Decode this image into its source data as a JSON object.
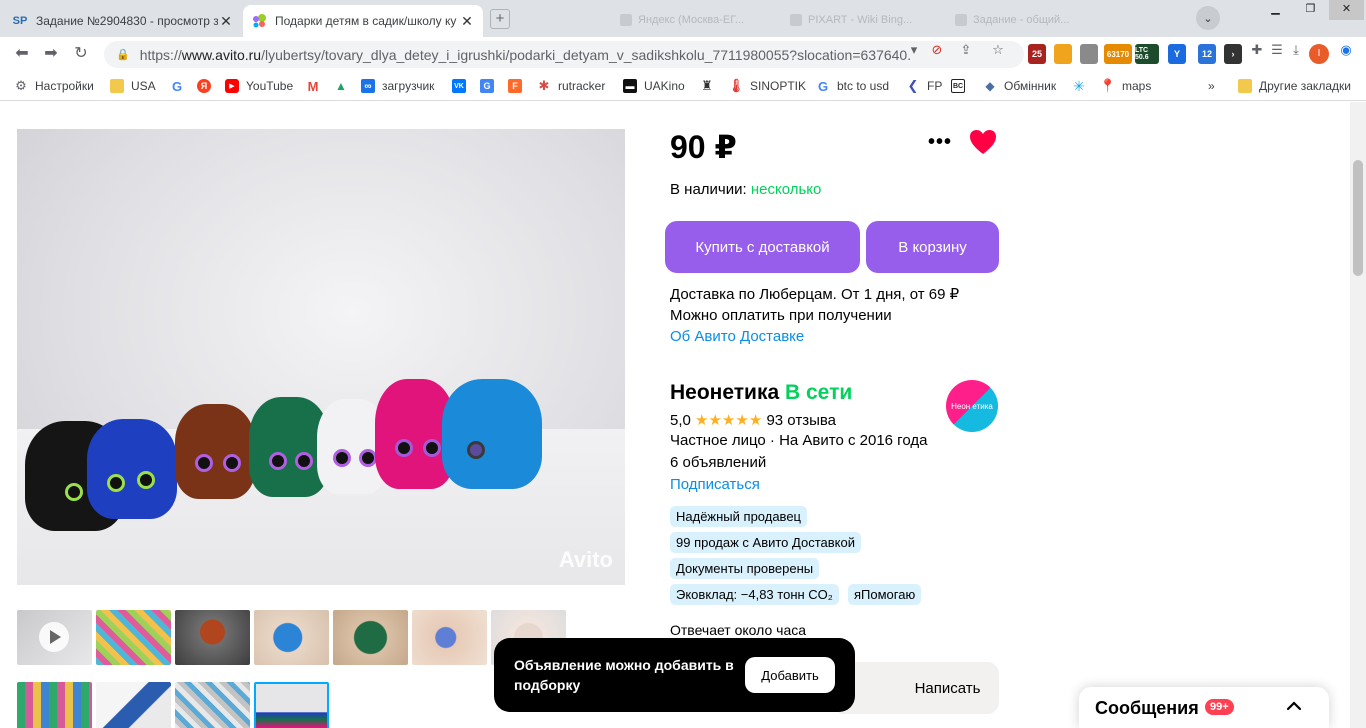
{
  "browser": {
    "tabs": [
      {
        "title": "Задание №2904830 - просмотр з",
        "favicon": "SP",
        "active": false
      },
      {
        "title": "Подарки детям в садик/школу ку",
        "favicon": "avito-logo",
        "active": true
      }
    ],
    "ghost_tabs": [
      "Яндекс (Москва-ЕГ...",
      "PIXART - Wiki Bing...",
      "Задание - общий..."
    ],
    "address": {
      "prefix": "https://",
      "host": "www.avito.ru",
      "path": "/lyubertsy/tovary_dlya_detey_i_igrushki/podarki_detyam_v_sadikshkolu_7711980055?slocation=637640..."
    },
    "extensions": [
      {
        "label": "25",
        "color": "#a8231f"
      },
      {
        "label": "",
        "color": "#f0a31c"
      },
      {
        "label": "",
        "color": "#8a8a8a"
      },
      {
        "label": "63170",
        "color": "#e68a00"
      },
      {
        "label": "LTC 50.6",
        "color": "#1c4c2c"
      },
      {
        "label": "",
        "color": "#1a6ae0"
      },
      {
        "label": "12",
        "color": "#2a73d9"
      },
      {
        "label": "",
        "color": "#333333"
      }
    ],
    "profile_initial": "I",
    "bookmarks": [
      {
        "label": "Настройки",
        "icon": "gear-icon",
        "color": "#5f6368"
      },
      {
        "label": "USA",
        "icon": "folder-icon",
        "color": "#f2c94c"
      },
      {
        "label": "",
        "icon": "google-icon",
        "color": "#4285f4"
      },
      {
        "label": "",
        "icon": "yandex-icon",
        "color": "#fc3f1d"
      },
      {
        "label": "YouTube",
        "icon": "youtube-icon",
        "color": "#ff0000"
      },
      {
        "label": "",
        "icon": "gmail-icon",
        "color": "#ea4335"
      },
      {
        "label": "",
        "icon": "drive-icon",
        "color": "#1fa463"
      },
      {
        "label": "загрузчик",
        "icon": "infinity-icon",
        "color": "#1a73e8"
      },
      {
        "label": "",
        "icon": "vk-icon",
        "color": "#0077ff"
      },
      {
        "label": "",
        "icon": "translate-icon",
        "color": "#4285f4"
      },
      {
        "label": "",
        "icon": "f-icon",
        "color": "#ff6a2b"
      },
      {
        "label": "rutracker",
        "icon": "rutracker-icon",
        "color": "#d84a4a"
      },
      {
        "label": "UAKino",
        "icon": "uakino-icon",
        "color": "#111111"
      },
      {
        "label": "",
        "icon": "person-icon",
        "color": "#333333"
      },
      {
        "label": "SINOPTIK",
        "icon": "thermometer-icon",
        "color": "#e53935"
      },
      {
        "label": "btc to usd",
        "icon": "google-icon",
        "color": "#4285f4"
      },
      {
        "label": "FP",
        "icon": "fp-icon",
        "color": "#3f51b5"
      },
      {
        "label": "",
        "icon": "bc-icon",
        "color": "#222222"
      },
      {
        "label": "Обмінник",
        "icon": "exchange-icon",
        "color": "#4a6fa5"
      },
      {
        "label": "",
        "icon": "star-burst-icon",
        "color": "#1aa3e8"
      },
      {
        "label": "maps",
        "icon": "maps-icon",
        "color": "#34a853"
      }
    ],
    "bookmarks_overflow": "»",
    "other_bookmarks": "Другие закладки"
  },
  "listing": {
    "price": "90 ₽",
    "stock_label": "В наличии:",
    "stock_value": "несколько",
    "buy_button": "Купить с доставкой",
    "cart_button": "В корзину",
    "delivery_line": "Доставка по Люберцам. От 1 дня, от 69 ₽",
    "payment_line": "Можно оплатить при получении",
    "delivery_link": "Об Авито Доставке",
    "photo_watermark": "Avito"
  },
  "seller": {
    "name": "Неонетика",
    "status": "В сети",
    "rating": "5,0",
    "stars": "★★★★★",
    "reviews": "93 отзыва",
    "type_line": "Частное лицо · На Авито с 2016 года",
    "ads_count": "6 объявлений",
    "subscribe": "Подписаться",
    "logo_text": "Неон етика",
    "badges": [
      "Надёжный продавец",
      "99 продаж с Авито Доставкой",
      "Документы проверены",
      "Эковклад: −4,83 тонн CO₂",
      "яПомогаю"
    ],
    "response_time": "Отвечает около часа",
    "write_button": "Написать"
  },
  "toast": {
    "message": "Объявление можно добавить в подборку",
    "button": "Добавить"
  },
  "messages": {
    "label": "Сообщения",
    "count": "99+"
  },
  "colors": {
    "accent_purple": "#965eeb",
    "online_green": "#02d15c",
    "link_blue": "#0a8ee5",
    "badge_bg": "#d9f1fd",
    "heart_red": "#ff0044",
    "star_orange": "#ffb021"
  }
}
